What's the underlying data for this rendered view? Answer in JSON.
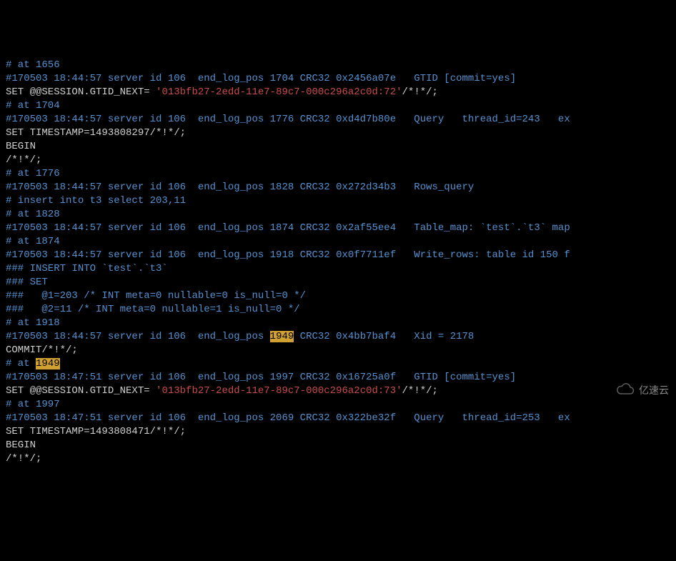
{
  "lines": [
    {
      "segments": [
        {
          "cls": "line",
          "text": "# at 1656"
        }
      ]
    },
    {
      "segments": [
        {
          "cls": "line",
          "text": "#170503 18:44:57 server id 106  end_log_pos 1704 CRC32 0x2456a07e   GTID [commit=yes]"
        }
      ]
    },
    {
      "segments": [
        {
          "cls": "white",
          "text": "SET @@SESSION.GTID_NEXT= "
        },
        {
          "cls": "red",
          "text": "'013bfb27-2edd-11e7-89c7-000c296a2c0d:72'"
        },
        {
          "cls": "white",
          "text": "/*!*/;"
        }
      ]
    },
    {
      "segments": [
        {
          "cls": "line",
          "text": "# at 1704"
        }
      ]
    },
    {
      "segments": [
        {
          "cls": "line",
          "text": "#170503 18:44:57 server id 106  end_log_pos 1776 CRC32 0xd4d7b80e   Query   thread_id=243   ex"
        }
      ]
    },
    {
      "segments": [
        {
          "cls": "white",
          "text": "SET TIMESTAMP=1493808297/*!*/;"
        }
      ]
    },
    {
      "segments": [
        {
          "cls": "white",
          "text": "BEGIN"
        }
      ]
    },
    {
      "segments": [
        {
          "cls": "white",
          "text": "/*!*/;"
        }
      ]
    },
    {
      "segments": [
        {
          "cls": "line",
          "text": "# at 1776"
        }
      ]
    },
    {
      "segments": [
        {
          "cls": "line",
          "text": "#170503 18:44:57 server id 106  end_log_pos 1828 CRC32 0x272d34b3   Rows_query"
        }
      ]
    },
    {
      "segments": [
        {
          "cls": "line",
          "text": "# insert into t3 select 203,11"
        }
      ]
    },
    {
      "segments": [
        {
          "cls": "line",
          "text": "# at 1828"
        }
      ]
    },
    {
      "segments": [
        {
          "cls": "line",
          "text": "#170503 18:44:57 server id 106  end_log_pos 1874 CRC32 0x2af55ee4   Table_map: `test`.`t3` map"
        }
      ]
    },
    {
      "segments": [
        {
          "cls": "line",
          "text": "# at 1874"
        }
      ]
    },
    {
      "segments": [
        {
          "cls": "line",
          "text": "#170503 18:44:57 server id 106  end_log_pos 1918 CRC32 0x0f7711ef   Write_rows: table id 150 f"
        }
      ]
    },
    {
      "segments": [
        {
          "cls": "line",
          "text": "### INSERT INTO `test`.`t3`"
        }
      ]
    },
    {
      "segments": [
        {
          "cls": "line",
          "text": "### SET"
        }
      ]
    },
    {
      "segments": [
        {
          "cls": "line",
          "text": "###   @1=203 /* INT meta=0 nullable=0 is_null=0 */"
        }
      ]
    },
    {
      "segments": [
        {
          "cls": "line",
          "text": "###   @2=11 /* INT meta=0 nullable=1 is_null=0 */"
        }
      ]
    },
    {
      "segments": [
        {
          "cls": "line",
          "text": "# at 1918"
        }
      ]
    },
    {
      "segments": [
        {
          "cls": "line",
          "text": "#170503 18:44:57 server id 106  end_log_pos "
        },
        {
          "cls": "hl",
          "text": "1949"
        },
        {
          "cls": "line",
          "text": " CRC32 0x4bb7baf4   Xid = 2178"
        }
      ]
    },
    {
      "segments": [
        {
          "cls": "white",
          "text": "COMMIT/*!*/;"
        }
      ]
    },
    {
      "segments": [
        {
          "cls": "line",
          "text": "# at "
        },
        {
          "cls": "hl",
          "text": "1949"
        }
      ]
    },
    {
      "segments": [
        {
          "cls": "line",
          "text": "#170503 18:47:51 server id 106  end_log_pos 1997 CRC32 0x16725a0f   GTID [commit=yes]"
        }
      ]
    },
    {
      "segments": [
        {
          "cls": "white",
          "text": "SET @@SESSION.GTID_NEXT= "
        },
        {
          "cls": "red",
          "text": "'013bfb27-2edd-11e7-89c7-000c296a2c0d:73'"
        },
        {
          "cls": "white",
          "text": "/*!*/;"
        }
      ]
    },
    {
      "segments": [
        {
          "cls": "line",
          "text": "# at 1997"
        }
      ]
    },
    {
      "segments": [
        {
          "cls": "line",
          "text": "#170503 18:47:51 server id 106  end_log_pos 2069 CRC32 0x322be32f   Query   thread_id=253   ex"
        }
      ]
    },
    {
      "segments": [
        {
          "cls": "white",
          "text": "SET TIMESTAMP=1493808471/*!*/;"
        }
      ]
    },
    {
      "segments": [
        {
          "cls": "white",
          "text": "BEGIN"
        }
      ]
    },
    {
      "segments": [
        {
          "cls": "white",
          "text": "/*!*/;"
        }
      ]
    }
  ],
  "watermark": {
    "text": "亿速云"
  }
}
